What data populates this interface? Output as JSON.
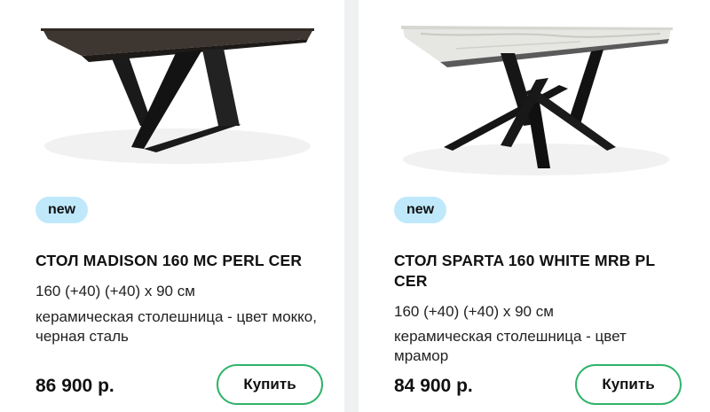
{
  "products": [
    {
      "badge": "new",
      "title": "СТОЛ MADISON 160 MC PERL CER",
      "dimensions": "160 (+40) (+40) x 90 см",
      "description": "керамическая столешница - цвет мокко, черная сталь",
      "price": "86 900 р.",
      "buy_label": "Купить",
      "image_icon": "table-madison-image"
    },
    {
      "badge": "new",
      "title": "СТОЛ SPARTA 160 WHITE MRB PL CER",
      "dimensions": "160 (+40) (+40) x 90 см",
      "description": "керамическая столешница - цвет мрамор",
      "price": "84 900 р.",
      "buy_label": "Купить",
      "image_icon": "table-sparta-image"
    }
  ],
  "colors": {
    "badge_bg": "#bfe9fb",
    "button_border": "#2fb36a",
    "page_bg": "#eef0f1",
    "card_bg": "#ffffff"
  }
}
